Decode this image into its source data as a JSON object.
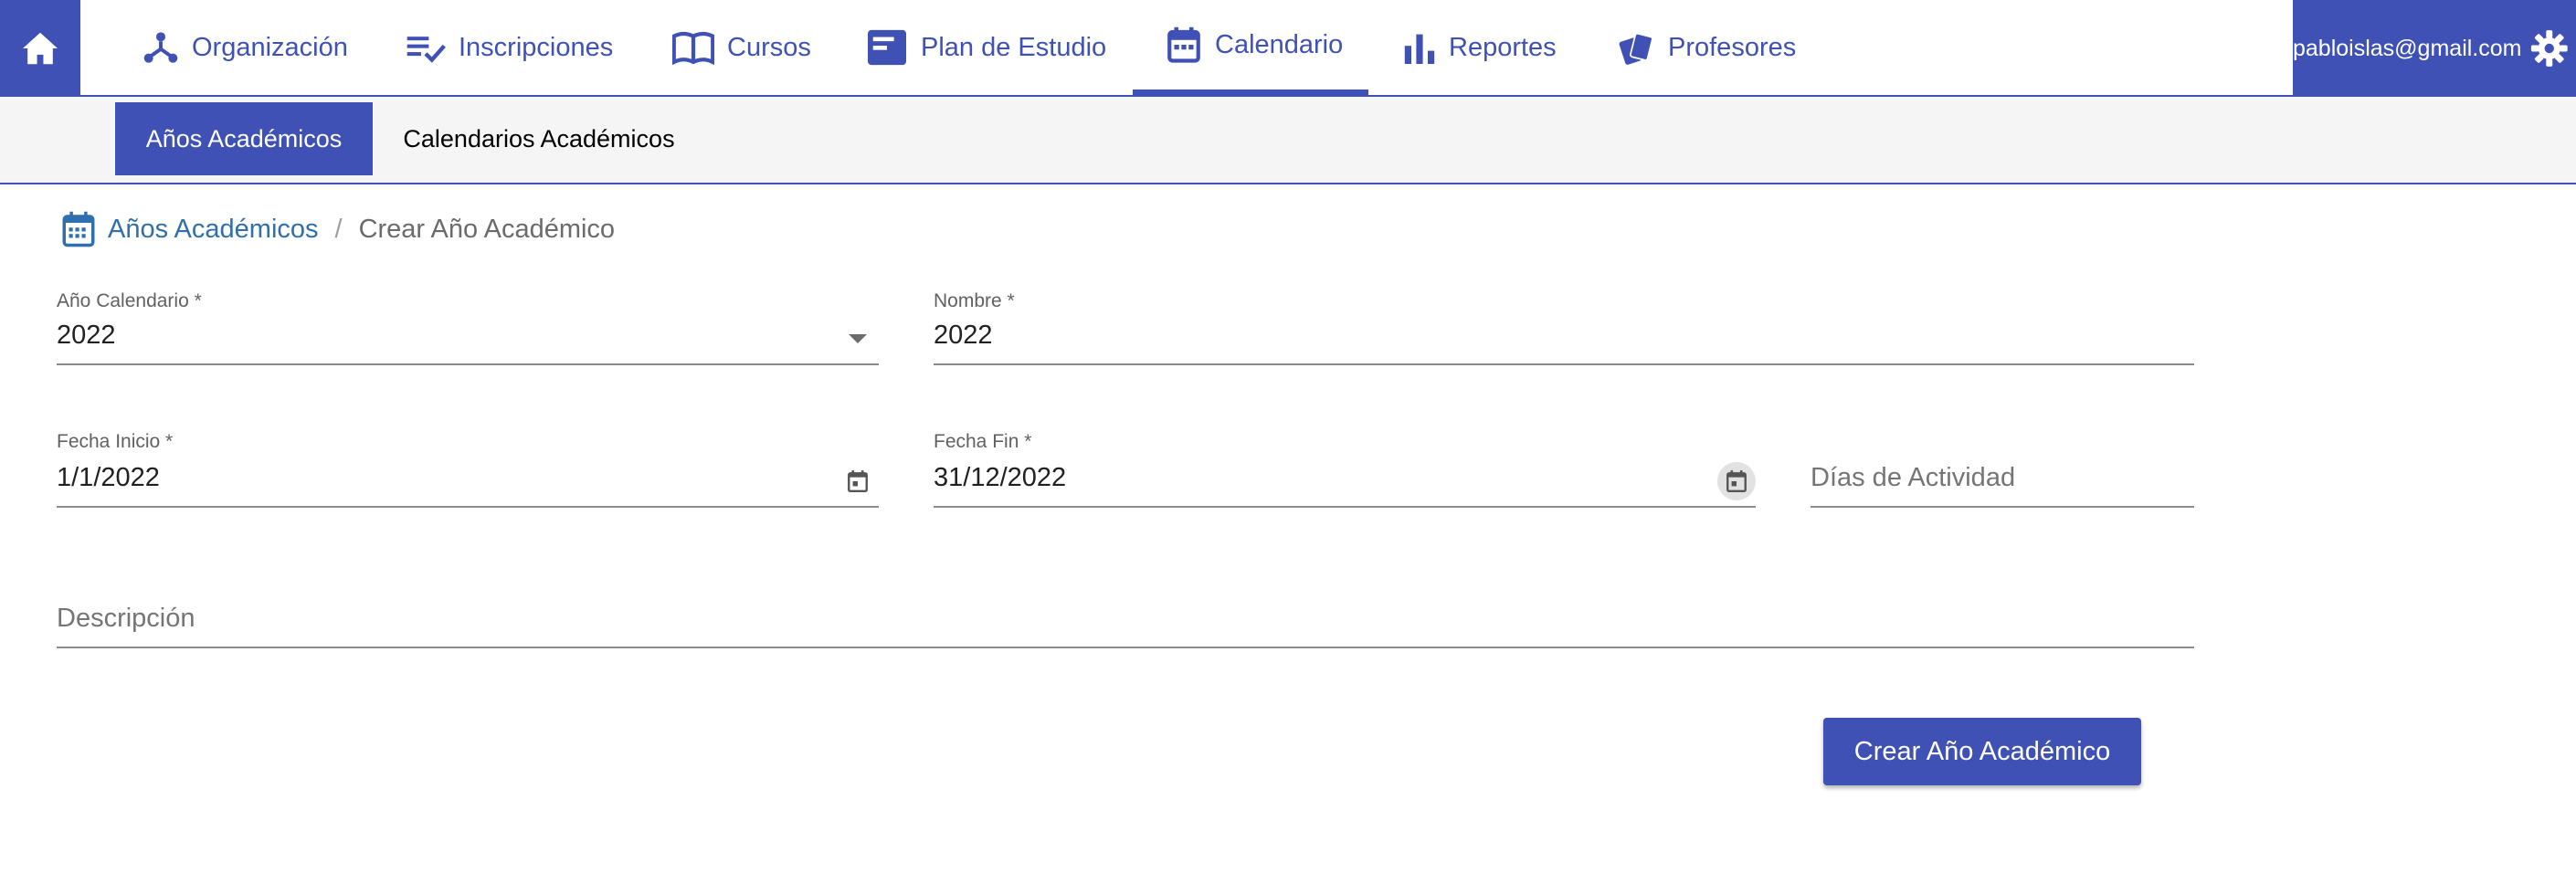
{
  "nav": {
    "items": [
      {
        "label": "Organización",
        "icon": "organization-icon"
      },
      {
        "label": "Inscripciones",
        "icon": "checklist-icon"
      },
      {
        "label": "Cursos",
        "icon": "book-icon"
      },
      {
        "label": "Plan de Estudio",
        "icon": "study-plan-icon"
      },
      {
        "label": "Calendario",
        "icon": "calendar-icon",
        "active": true
      },
      {
        "label": "Reportes",
        "icon": "bar-chart-icon"
      },
      {
        "label": "Profesores",
        "icon": "cards-icon"
      }
    ],
    "user_email": "pabloislas@gmail.com"
  },
  "subnav": {
    "tabs": [
      {
        "label": "Años Académicos",
        "active": true
      },
      {
        "label": "Calendarios Académicos",
        "active": false
      }
    ]
  },
  "breadcrumb": {
    "link": "Años Académicos",
    "separator": "/",
    "current": "Crear Año Académico"
  },
  "form": {
    "anio_calendario": {
      "label": "Año Calendario *",
      "value": "2022"
    },
    "nombre": {
      "label": "Nombre *",
      "value": "2022"
    },
    "fecha_inicio": {
      "label": "Fecha Inicio *",
      "value": "1/1/2022"
    },
    "fecha_fin": {
      "label": "Fecha Fin *",
      "value": "31/12/2022"
    },
    "dias_actividad": {
      "placeholder": "Días de Actividad"
    },
    "descripcion": {
      "placeholder": "Descripción"
    },
    "submit_label": "Crear Año Académico"
  },
  "colors": {
    "primary": "#3f51b5",
    "link": "#2f6fae",
    "subbar_bg": "#f5f5f5"
  }
}
